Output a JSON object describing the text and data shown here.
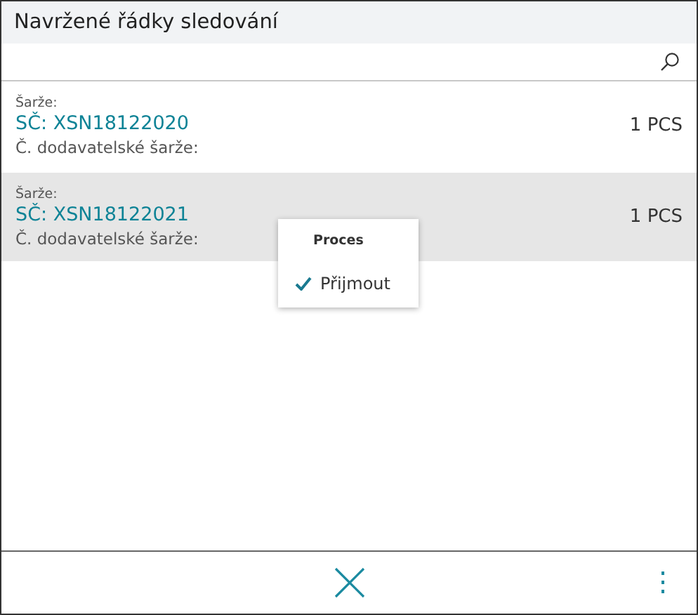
{
  "window": {
    "title": "Navržené řádky sledování"
  },
  "rows": [
    {
      "label": "Šarže:",
      "serial": "SČ: XSN18122020",
      "quantity": "1 PCS",
      "vendor_lot_label": "Č. dodavatelské šarže:",
      "selected": false
    },
    {
      "label": "Šarže:",
      "serial": "SČ: XSN18122021",
      "quantity": "1 PCS",
      "vendor_lot_label": "Č. dodavatelské šarže:",
      "selected": true
    }
  ],
  "context_menu": {
    "title": "Proces",
    "items": [
      {
        "label": "Přijmout",
        "checked": true
      }
    ]
  }
}
